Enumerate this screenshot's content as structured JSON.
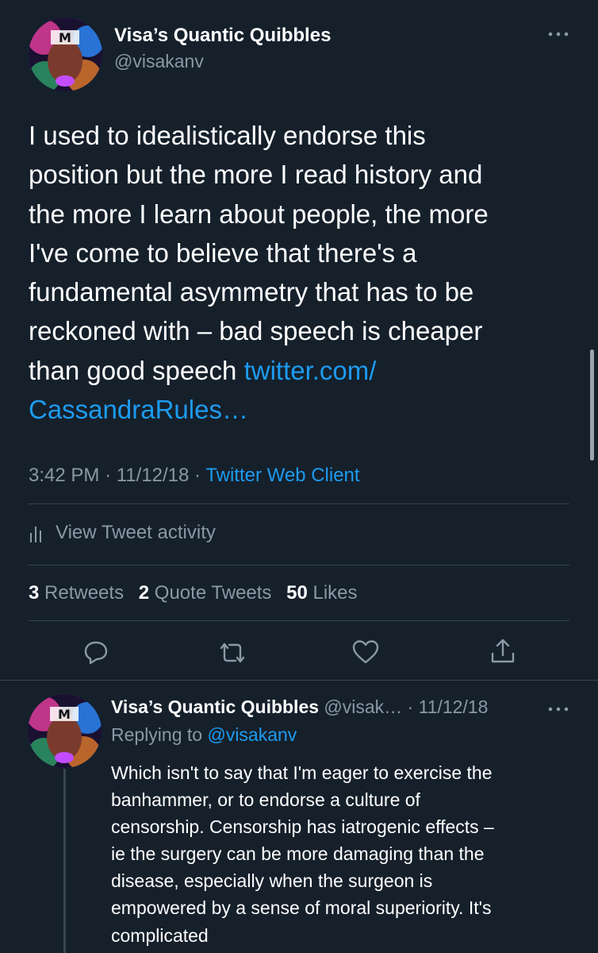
{
  "main_tweet": {
    "author": {
      "display_name": "Visa’s Quantic Quibbles",
      "handle": "@visakanv"
    },
    "text_lines": [
      "I used to idealistically endorse this",
      "position but the more I read history and",
      "the more I learn about people, the more",
      "I've come to believe that there's a",
      "fundamental asymmetry that has to be",
      "reckoned with – bad speech is cheaper",
      "than good speech "
    ],
    "link_part1": "twitter.com/",
    "link_part2": "CassandraRules…",
    "time": "3:42 PM",
    "date": "11/12/18",
    "source": "Twitter Web Client",
    "activity_label": "View Tweet activity",
    "stats": {
      "retweets_count": "3",
      "retweets_label": "Retweets",
      "quote_count": "2",
      "quote_label": "Quote Tweets",
      "likes_count": "50",
      "likes_label": "Likes"
    }
  },
  "reply_tweet": {
    "display_name": "Visa’s Quantic Quibbles",
    "handle_truncated": "@visak…",
    "date": "11/12/18",
    "replying_prefix": "Replying to",
    "replying_to": "@visakanv",
    "text_lines": [
      "Which isn't to say that I'm eager to exercise the",
      "banhammer, or to endorse a culture of",
      "censorship. Censorship has iatrogenic effects –",
      "ie the surgery can be more damaging than the",
      "disease, especially when the surgeon is",
      "empowered by a sense of moral superiority. It's",
      "complicated"
    ]
  },
  "icons": {
    "more": "more-horizontal-icon",
    "activity": "bar-chart-icon",
    "reply": "reply-icon",
    "retweet": "retweet-icon",
    "like": "heart-icon",
    "share": "share-icon"
  },
  "colors": {
    "background": "#15202b",
    "text": "#ffffff",
    "secondary": "#8b98a5",
    "link": "#1d9bf0",
    "divider": "#38444d"
  }
}
